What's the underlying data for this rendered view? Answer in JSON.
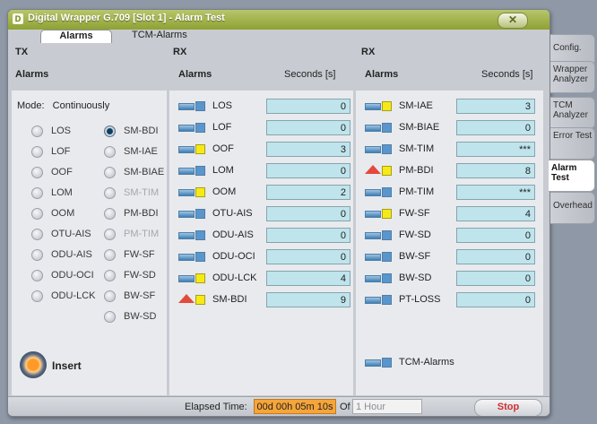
{
  "window": {
    "title": "Digital Wrapper G.709 [Slot 1] - Alarm Test",
    "title_icon": "D"
  },
  "subtabs": {
    "alarms": "Alarms",
    "tcm": "TCM-Alarms"
  },
  "tx": {
    "heading": "TX",
    "column": "Alarms",
    "mode_label": "Mode:",
    "mode_value": "Continuously",
    "left_options": [
      {
        "label": "LOS",
        "selected": false,
        "enabled": true
      },
      {
        "label": "LOF",
        "selected": false,
        "enabled": true
      },
      {
        "label": "OOF",
        "selected": false,
        "enabled": true
      },
      {
        "label": "LOM",
        "selected": false,
        "enabled": true
      },
      {
        "label": "OOM",
        "selected": false,
        "enabled": true
      },
      {
        "label": "OTU-AIS",
        "selected": false,
        "enabled": true
      },
      {
        "label": "ODU-AIS",
        "selected": false,
        "enabled": true
      },
      {
        "label": "ODU-OCI",
        "selected": false,
        "enabled": true
      },
      {
        "label": "ODU-LCK",
        "selected": false,
        "enabled": true
      }
    ],
    "right_options": [
      {
        "label": "SM-BDI",
        "selected": true,
        "enabled": true
      },
      {
        "label": "SM-IAE",
        "selected": false,
        "enabled": true
      },
      {
        "label": "SM-BIAE",
        "selected": false,
        "enabled": true
      },
      {
        "label": "SM-TIM",
        "selected": false,
        "enabled": false
      },
      {
        "label": "PM-BDI",
        "selected": false,
        "enabled": true
      },
      {
        "label": "PM-TIM",
        "selected": false,
        "enabled": false
      },
      {
        "label": "FW-SF",
        "selected": false,
        "enabled": true
      },
      {
        "label": "FW-SD",
        "selected": false,
        "enabled": true
      },
      {
        "label": "BW-SF",
        "selected": false,
        "enabled": true
      },
      {
        "label": "BW-SD",
        "selected": false,
        "enabled": true
      }
    ],
    "insert_label": "Insert"
  },
  "rx1": {
    "heading": "RX",
    "column": "Alarms",
    "seconds_header": "Seconds [s]",
    "rows": [
      {
        "label": "LOS",
        "value": "0",
        "led": "bar",
        "square": "blue"
      },
      {
        "label": "LOF",
        "value": "0",
        "led": "bar",
        "square": "blue"
      },
      {
        "label": "OOF",
        "value": "3",
        "led": "bar",
        "square": "yellow"
      },
      {
        "label": "LOM",
        "value": "0",
        "led": "bar",
        "square": "blue"
      },
      {
        "label": "OOM",
        "value": "2",
        "led": "bar",
        "square": "yellow"
      },
      {
        "label": "OTU-AIS",
        "value": "0",
        "led": "bar",
        "square": "blue"
      },
      {
        "label": "ODU-AIS",
        "value": "0",
        "led": "bar",
        "square": "blue"
      },
      {
        "label": "ODU-OCI",
        "value": "0",
        "led": "bar",
        "square": "blue"
      },
      {
        "label": "ODU-LCK",
        "value": "4",
        "led": "bar",
        "square": "yellow"
      },
      {
        "label": "SM-BDI",
        "value": "9",
        "led": "triangle",
        "square": "yellow"
      }
    ]
  },
  "rx2": {
    "heading": "RX",
    "column": "Alarms",
    "seconds_header": "Seconds [s]",
    "rows": [
      {
        "label": "SM-IAE",
        "value": "3",
        "led": "bar",
        "square": "yellow"
      },
      {
        "label": "SM-BIAE",
        "value": "0",
        "led": "bar",
        "square": "blue"
      },
      {
        "label": "SM-TIM",
        "value": "***",
        "led": "bar",
        "square": "blue"
      },
      {
        "label": "PM-BDI",
        "value": "8",
        "led": "triangle",
        "square": "yellow"
      },
      {
        "label": "PM-TIM",
        "value": "***",
        "led": "bar",
        "square": "blue"
      },
      {
        "label": "FW-SF",
        "value": "4",
        "led": "bar",
        "square": "yellow"
      },
      {
        "label": "FW-SD",
        "value": "0",
        "led": "bar",
        "square": "blue"
      },
      {
        "label": "BW-SF",
        "value": "0",
        "led": "bar",
        "square": "blue"
      },
      {
        "label": "BW-SD",
        "value": "0",
        "led": "bar",
        "square": "blue"
      },
      {
        "label": "PT-LOSS",
        "value": "0",
        "led": "bar",
        "square": "blue"
      }
    ],
    "tcm_label": "TCM-Alarms"
  },
  "side_tabs": [
    {
      "label": "Config.",
      "active": false
    },
    {
      "label": "Wrapper Analyzer",
      "active": false
    },
    {
      "label": "TCM Analyzer",
      "active": false
    },
    {
      "label": "Error Test",
      "active": false
    },
    {
      "label": "Alarm Test",
      "active": true
    },
    {
      "label": "Overhead",
      "active": false
    }
  ],
  "status": {
    "elapsed_label": "Elapsed Time:",
    "elapsed_value": "00d 00h 05m 10s",
    "of_label": "Of",
    "duration_placeholder": "1 Hour",
    "stop_label": "Stop"
  },
  "colors": {
    "accent_green": "#8ea133",
    "field_cyan": "#bfe4ec",
    "elapsed_orange": "#f6a53a",
    "alarm_red": "#e34a3c",
    "led_yellow": "#f6ea16"
  }
}
